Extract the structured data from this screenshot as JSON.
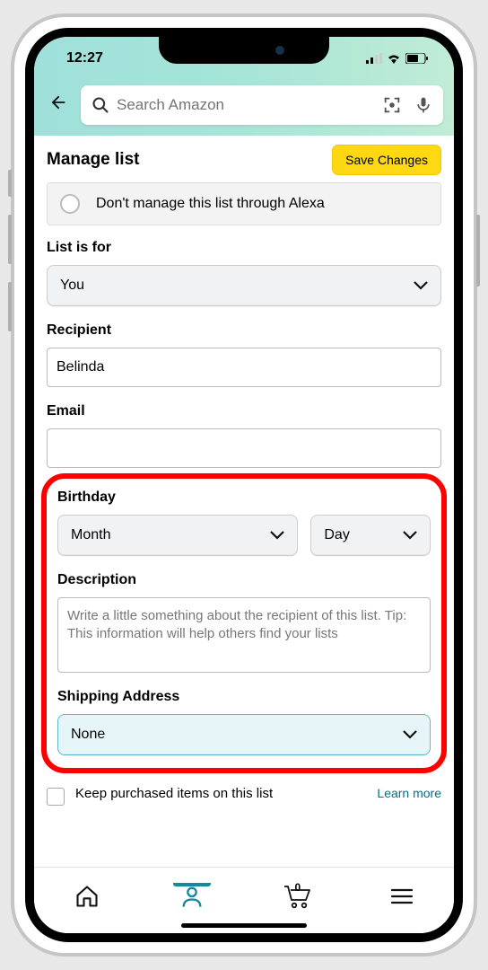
{
  "status": {
    "time": "12:27"
  },
  "search": {
    "placeholder": "Search Amazon"
  },
  "header": {
    "title": "Manage list",
    "save": "Save Changes"
  },
  "alexa": {
    "label": "Don't manage this list through Alexa"
  },
  "list_for": {
    "label": "List is for",
    "value": "You"
  },
  "recipient": {
    "label": "Recipient",
    "value": "Belinda"
  },
  "email": {
    "label": "Email",
    "value": ""
  },
  "birthday": {
    "label": "Birthday",
    "month": "Month",
    "day": "Day"
  },
  "description": {
    "label": "Description",
    "placeholder": "Write a little something about the recipient of this list. Tip: This information will help others find your lists"
  },
  "shipping": {
    "label": "Shipping Address",
    "value": "None"
  },
  "keep": {
    "label": "Keep purchased items on this list",
    "learn": "Learn more"
  },
  "cart": {
    "count": "0"
  }
}
